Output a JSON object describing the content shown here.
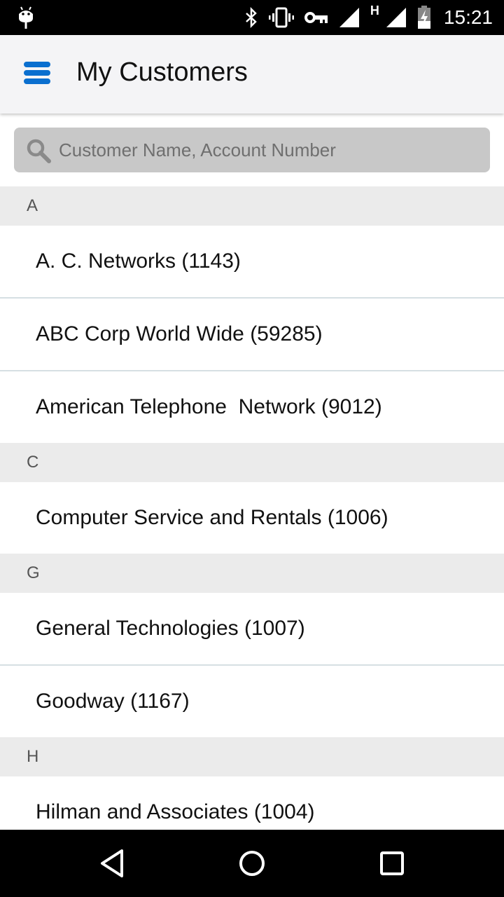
{
  "status_bar": {
    "time": "15:21",
    "network_type": "H",
    "icons": [
      "android-debug-icon",
      "bluetooth-icon",
      "vibrate-icon",
      "vpn-key-icon",
      "signal-icon",
      "signal-icon",
      "battery-charging-icon"
    ]
  },
  "app_bar": {
    "title": "My Customers",
    "menu_icon": "hamburger-menu-icon",
    "accent_color": "#0a6fcf"
  },
  "search": {
    "placeholder": "Customer Name, Account Number",
    "value": "",
    "icon": "search-icon"
  },
  "sections": [
    {
      "letter": "A",
      "customers": [
        "A. C. Networks (1143)",
        "ABC Corp World Wide (59285)",
        "American Telephone  Network (9012)"
      ]
    },
    {
      "letter": "C",
      "customers": [
        "Computer Service and Rentals (1006)"
      ]
    },
    {
      "letter": "G",
      "customers": [
        "General Technologies (1007)",
        "Goodway (1167)"
      ]
    },
    {
      "letter": "H",
      "customers": [
        "Hilman and Associates (1004)"
      ]
    }
  ],
  "nav_bar": {
    "buttons": [
      "back-icon",
      "home-icon",
      "recent-apps-icon"
    ]
  }
}
